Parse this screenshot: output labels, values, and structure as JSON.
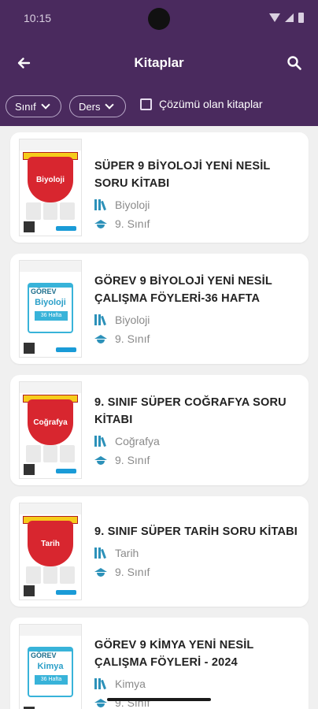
{
  "status_bar": {
    "time": "10:15"
  },
  "appbar": {
    "title": "Kitaplar",
    "back_icon": "arrow-left-icon",
    "search_icon": "search-icon"
  },
  "filters": {
    "class_chip": "Sınıf",
    "subject_chip": "Ders",
    "solutions_checkbox": "Çözümü olan kitaplar"
  },
  "books": [
    {
      "title": "SÜPER 9 BİYOLOJİ YENİ NESİL SORU KİTABI",
      "subject": "Biyoloji",
      "grade": "9. Sınıf",
      "cover_style": "super",
      "cover_label": "Biyoloji",
      "cover_color": "#d8262f"
    },
    {
      "title": "GÖREV 9 BİYOLOJİ YENİ NESİL ÇALIŞMA FÖYLERİ-36 HAFTA",
      "subject": "Biyoloji",
      "grade": "9. Sınıf",
      "cover_style": "gorev",
      "cover_label": "Biyoloji",
      "cover_color": "#38b3d9"
    },
    {
      "title": "9. SINIF SÜPER COĞRAFYA SORU KİTABI",
      "subject": "Coğrafya",
      "grade": "9. Sınıf",
      "cover_style": "super",
      "cover_label": "Coğrafya",
      "cover_color": "#d8262f"
    },
    {
      "title": "9. SINIF SÜPER TARİH SORU KİTABI",
      "subject": "Tarih",
      "grade": "9. Sınıf",
      "cover_style": "super",
      "cover_label": "Tarih",
      "cover_color": "#d8262f"
    },
    {
      "title": "GÖREV 9 KİMYA YENİ NESİL ÇALIŞMA FÖYLERİ - 2024",
      "subject": "Kimya",
      "grade": "9. Sınıf",
      "cover_style": "gorev",
      "cover_label": "Kimya",
      "cover_color": "#38b3d9"
    }
  ],
  "colors": {
    "header": "#4a2a5e",
    "accent": "#2c91b9",
    "background": "#f0f0f0"
  }
}
